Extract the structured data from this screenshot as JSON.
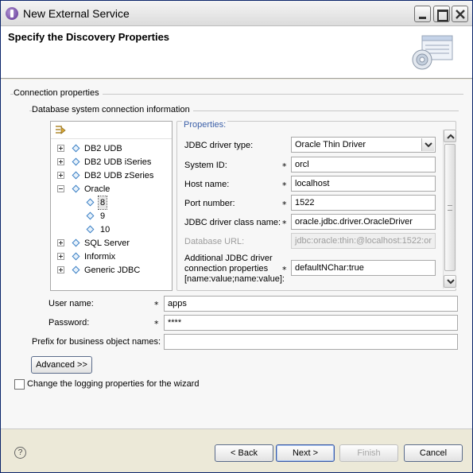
{
  "window": {
    "title": "New External Service",
    "min_icon": "minimize-icon",
    "max_icon": "maximize-icon",
    "close_icon": "close-icon"
  },
  "header": {
    "title": "Specify the Discovery Properties"
  },
  "connection": {
    "group_label": "Connection properties",
    "db_group_label": "Database system connection information"
  },
  "tree": {
    "toolbar_icon": "collapse-filter-icon",
    "items": [
      {
        "label": "DB2 UDB"
      },
      {
        "label": "DB2 UDB iSeries"
      },
      {
        "label": "DB2 UDB zSeries"
      },
      {
        "label": "Oracle"
      },
      {
        "label": "8"
      },
      {
        "label": "9"
      },
      {
        "label": "10"
      },
      {
        "label": "SQL Server"
      },
      {
        "label": "Informix"
      },
      {
        "label": "Generic JDBC"
      }
    ],
    "selected": "8"
  },
  "properties": {
    "title": "Properties:",
    "jdbc_driver_type": {
      "label": "JDBC driver type:",
      "value": "Oracle Thin Driver"
    },
    "system_id": {
      "label": "System ID:",
      "value": "orcl",
      "required": "*"
    },
    "host_name": {
      "label": "Host name:",
      "value": "localhost",
      "required": "*"
    },
    "port_number": {
      "label": "Port number:",
      "value": "1522",
      "required": "*"
    },
    "driver_class": {
      "label": "JDBC driver class name:",
      "value": "oracle.jdbc.driver.OracleDriver",
      "required": "*"
    },
    "database_url": {
      "label": "Database URL:",
      "value": "jdbc:oracle:thin:@localhost:1522:or"
    },
    "additional": {
      "label_line1": "Additional JDBC driver",
      "label_line2": "connection properties",
      "label_line3": "[name:value;name:value]:",
      "value": "defaultNChar:true",
      "required": "*"
    }
  },
  "user": {
    "user_name_label": "User name:",
    "user_name_value": "apps",
    "password_label": "Password:",
    "password_value": "****",
    "prefix_label": "Prefix for business object names:",
    "prefix_value": "",
    "required": "*"
  },
  "advanced_button": "Advanced >>",
  "logging_checkbox": {
    "label": "Change the logging properties for the wizard",
    "checked": false
  },
  "footer": {
    "help": "?",
    "back": "< Back",
    "next": "Next >",
    "finish": "Finish",
    "cancel": "Cancel"
  },
  "colors": {
    "properties_title": "#3b5fa8",
    "title_gradient_top": "#f4f4f4"
  }
}
